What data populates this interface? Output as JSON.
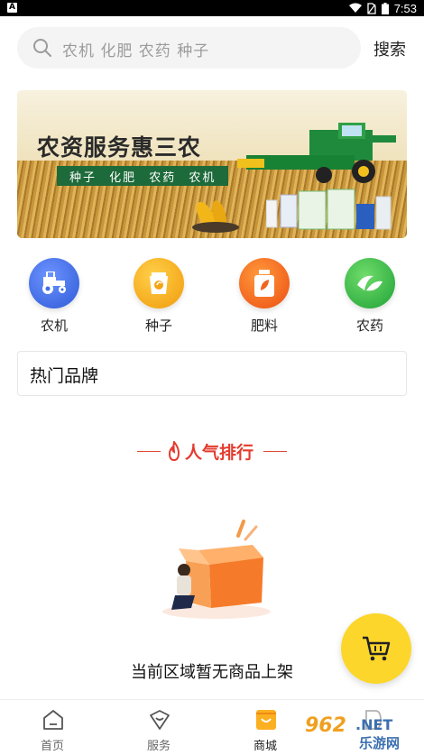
{
  "status_bar": {
    "time": "7:53",
    "left_icon_letter": "A"
  },
  "search": {
    "placeholder": "农机 化肥 农药 种子",
    "button_label": "搜索"
  },
  "banner": {
    "title": "农资服务惠三农",
    "subtitle": "种子  化肥  农药  农机"
  },
  "categories": [
    {
      "label": "农机",
      "icon": "tractor-icon",
      "color": "#3f6fe0"
    },
    {
      "label": "种子",
      "icon": "seed-icon",
      "color": "#f5a414"
    },
    {
      "label": "肥料",
      "icon": "fertilizer-icon",
      "color": "#f2641e"
    },
    {
      "label": "农药",
      "icon": "pesticide-icon",
      "color": "#35b548"
    }
  ],
  "hot_brands": {
    "title": "热门品牌"
  },
  "ranking": {
    "title": "人气排行"
  },
  "empty_state": {
    "message": "当前区域暂无商品上架"
  },
  "cart_fab": {
    "icon": "cart-icon",
    "color": "#fcd62a"
  },
  "bottom_nav": {
    "items": [
      {
        "label": "首页",
        "icon": "home-icon"
      },
      {
        "label": "服务",
        "icon": "service-icon"
      },
      {
        "label": "商城",
        "icon": "mall-icon",
        "active": true
      },
      {
        "label": "",
        "icon": "profile-icon"
      }
    ]
  },
  "watermark": {
    "text_top": "962.NET",
    "text_bottom": "乐游网"
  }
}
